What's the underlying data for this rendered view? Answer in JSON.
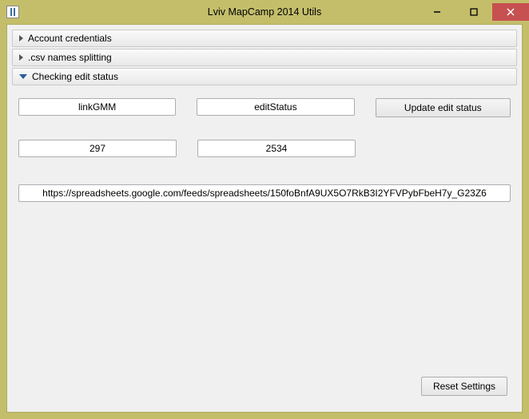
{
  "window": {
    "title": "Lviv MapCamp 2014 Utils"
  },
  "accordion": {
    "items": [
      {
        "label": "Account credentials",
        "expanded": false
      },
      {
        "label": ".csv names splitting",
        "expanded": false
      },
      {
        "label": "Checking edit status",
        "expanded": true
      }
    ]
  },
  "editStatusPanel": {
    "linkColumn": "linkGMM",
    "statusColumn": "editStatus",
    "updateButton": "Update edit status",
    "value1": "297",
    "value2": "2534",
    "feedUrl": "https://spreadsheets.google.com/feeds/spreadsheets/150foBnfA9UX5O7RkB3I2YFVPybFbeH7y_G23Z6"
  },
  "footer": {
    "resetButton": "Reset Settings"
  }
}
